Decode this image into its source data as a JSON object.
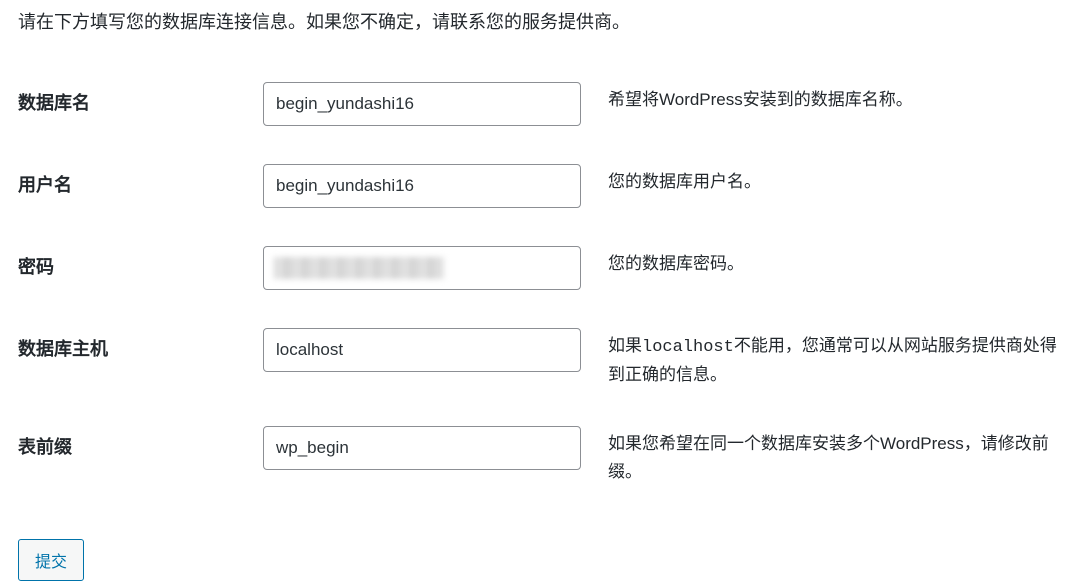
{
  "intro": "请在下方填写您的数据库连接信息。如果您不确定，请联系您的服务提供商。",
  "fields": {
    "dbname": {
      "label": "数据库名",
      "value": "begin_yundashi16",
      "description": "希望将WordPress安装到的数据库名称。"
    },
    "username": {
      "label": "用户名",
      "value": "begin_yundashi16",
      "description": "您的数据库用户名。"
    },
    "password": {
      "label": "密码",
      "value": "",
      "description": "您的数据库密码。"
    },
    "dbhost": {
      "label": "数据库主机",
      "value": "localhost",
      "desc_prefix": "如果",
      "desc_code": "localhost",
      "desc_suffix": "不能用，您通常可以从网站服务提供商处得到正确的信息。"
    },
    "prefix": {
      "label": "表前缀",
      "value": "wp_begin",
      "description": "如果您希望在同一个数据库安装多个WordPress，请修改前缀。"
    }
  },
  "submit_label": "提交"
}
